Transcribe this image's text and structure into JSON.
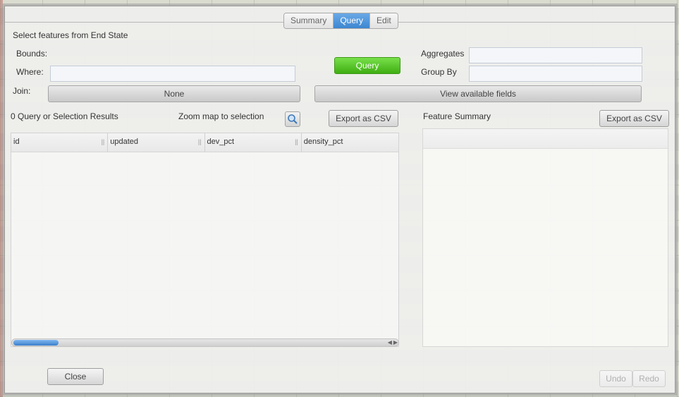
{
  "tabs": [
    {
      "label": "Summary"
    },
    {
      "label": "Query"
    },
    {
      "label": "Edit"
    }
  ],
  "heading": "Select features from End State",
  "labels": {
    "bounds": "Bounds:",
    "where": "Where:",
    "join": "Join:",
    "aggregates": "Aggregates",
    "group_by": "Group By"
  },
  "buttons": {
    "query": "Query",
    "join_select": "None",
    "view_fields": "View available fields",
    "export_left": "Export as CSV",
    "export_right": "Export as CSV",
    "close": "Close",
    "undo": "Undo",
    "redo": "Redo"
  },
  "results": {
    "count_label": "0 Query or Selection Results",
    "zoom_label": "Zoom map to selection",
    "columns": [
      "id",
      "updated",
      "dev_pct",
      "density_pct"
    ]
  },
  "feature_summary": {
    "title": "Feature Summary"
  },
  "scrollbar": {
    "position": 0.0
  },
  "colors": {
    "accent": "#3d86d1",
    "query_button": "#48b81a"
  }
}
